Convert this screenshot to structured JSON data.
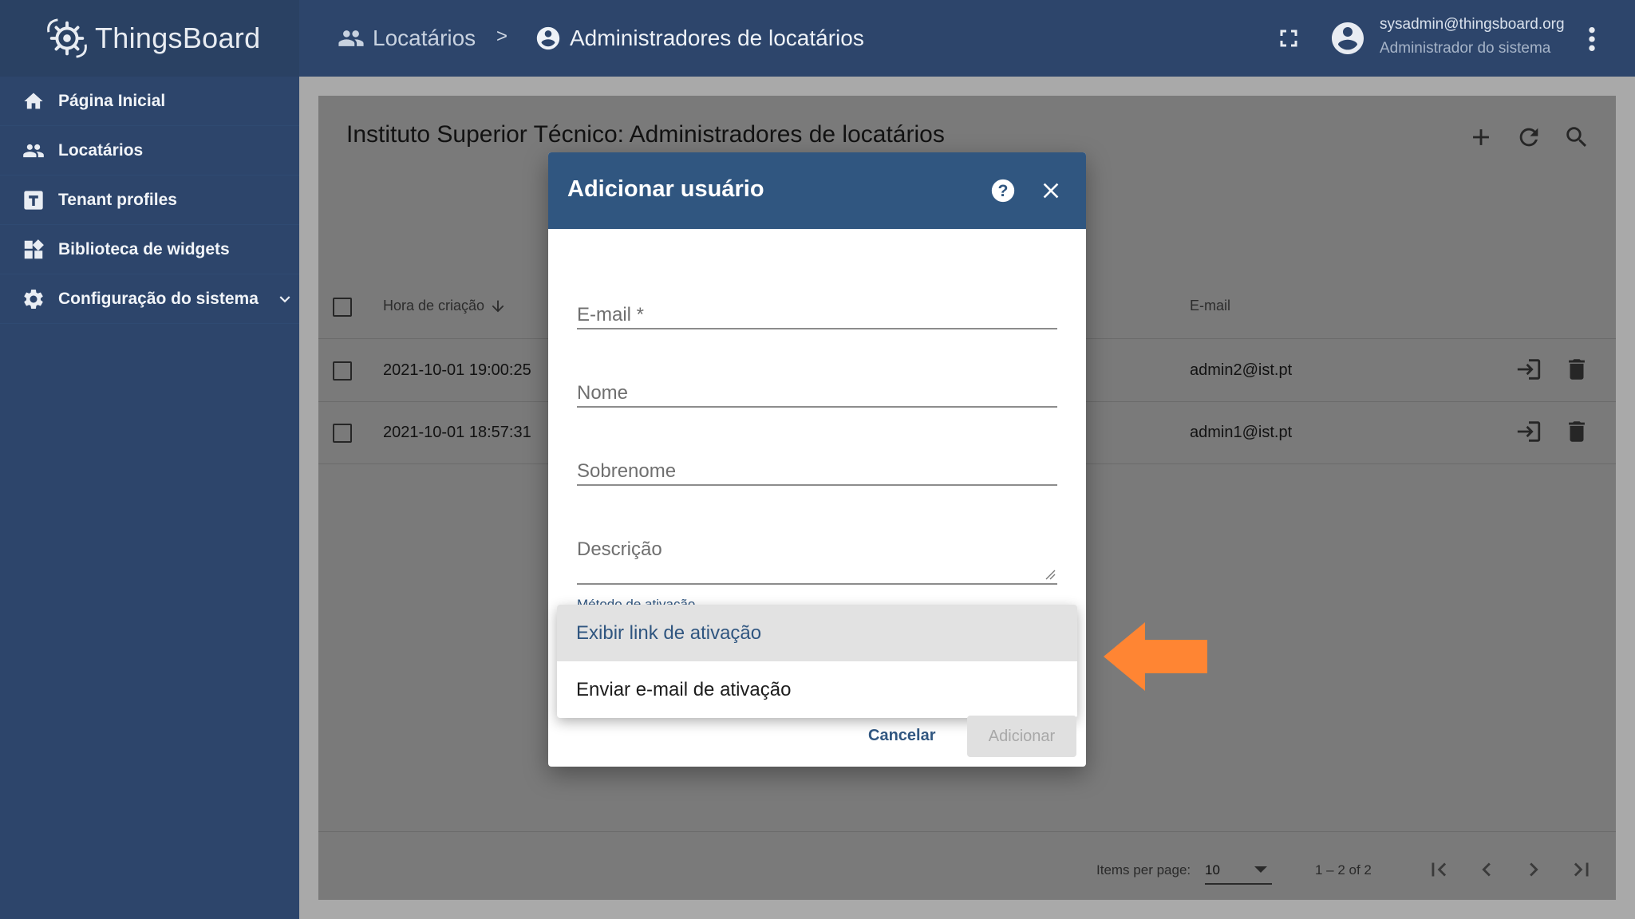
{
  "app": {
    "logo_text": "ThingsBoard"
  },
  "sidebar": {
    "items": [
      {
        "label": "Página Inicial",
        "icon": "home-icon"
      },
      {
        "label": "Locatários",
        "icon": "people-icon"
      },
      {
        "label": "Tenant profiles",
        "icon": "tenant-profile-icon"
      },
      {
        "label": "Biblioteca de widgets",
        "icon": "widgets-icon"
      },
      {
        "label": "Configuração do sistema",
        "icon": "gear-icon"
      }
    ]
  },
  "header": {
    "breadcrumb": [
      {
        "label": "Locatários",
        "icon": "people-icon"
      },
      {
        "label": "Administradores de locatários",
        "icon": "account-circle-icon"
      }
    ],
    "separator": ">",
    "user": {
      "email": "sysadmin@thingsboard.org",
      "role": "Administrador do sistema"
    }
  },
  "card": {
    "title": "Instituto Superior Técnico: Administradores de locatários",
    "columns": {
      "created": "Hora de criação",
      "email": "E-mail"
    },
    "rows": [
      {
        "created": "2021-10-01 19:00:25",
        "email": "admin2@ist.pt"
      },
      {
        "created": "2021-10-01 18:57:31",
        "email": "admin1@ist.pt"
      }
    ],
    "paginator": {
      "items_per_page_label": "Items per page:",
      "page_size": "10",
      "range": "1 – 2 of 2"
    }
  },
  "dialog": {
    "title": "Adicionar usuário",
    "fields": {
      "email": "E-mail *",
      "first_name": "Nome",
      "last_name": "Sobrenome",
      "description": "Descrição"
    },
    "activation_label": "Método de ativação",
    "activation_options": [
      "Exibir link de ativação",
      "Enviar e-mail de ativação"
    ],
    "cancel_label": "Cancelar",
    "add_label": "Adicionar"
  },
  "colors": {
    "primary": "#305680",
    "sidebar": "#2d456b",
    "annotation_arrow": "#ff8533"
  }
}
